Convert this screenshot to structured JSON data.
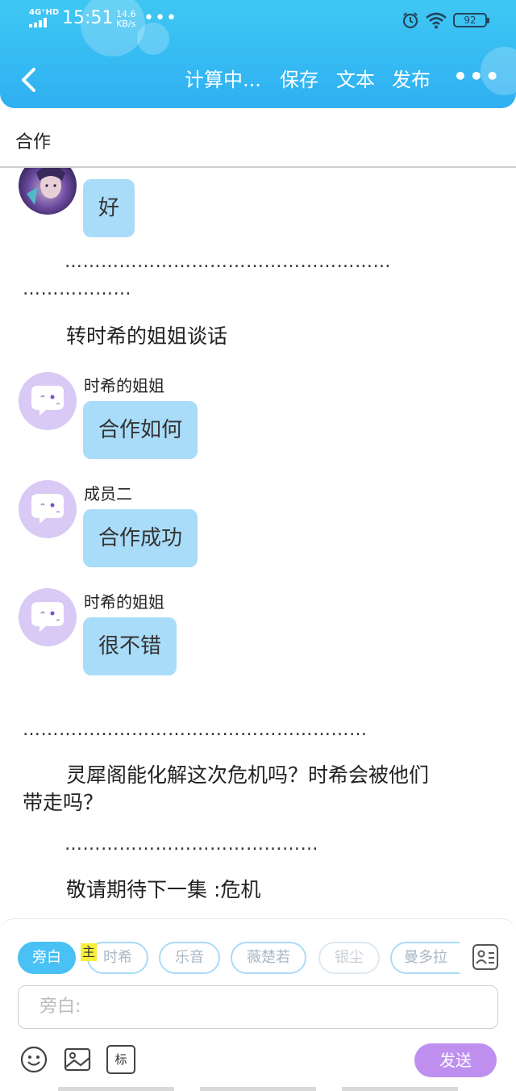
{
  "status_bar": {
    "network": "4G⁺HD",
    "time": "15:51",
    "speed_value": "14.6",
    "speed_unit": "KB/s",
    "more": "•••",
    "battery": "92"
  },
  "navbar": {
    "items": [
      "计算中...",
      "保存",
      "文本",
      "发布"
    ],
    "more": "•••"
  },
  "chapter_title": "合作",
  "conversation": {
    "first_message": "好",
    "dots_1a": "………………………………………………",
    "dots_1b": "………………",
    "narration_1": "转时希的姐姐谈话",
    "messages": [
      {
        "sender": "时希的姐姐",
        "text": "合作如何"
      },
      {
        "sender": "成员二",
        "text": "合作成功"
      },
      {
        "sender": "时希的姐姐",
        "text": "很不错"
      }
    ],
    "dots_2": "…………………………………………………",
    "narration_2_line1": "灵犀阁能化解这次危机吗？时希会被他们",
    "narration_2_line2": "带走吗？",
    "dots_3": "……………………………………",
    "narration_3": "敬请期待下一集 :危机"
  },
  "input_panel": {
    "roles": [
      "旁白",
      "时希",
      "乐音",
      "薇楚若",
      "银尘",
      "曼多拉"
    ],
    "main_tag": "主",
    "placeholder": "旁白:",
    "send_label": "发送",
    "tool_tag_label": "标"
  },
  "colors": {
    "header": "#3fc7f3",
    "bubble": "#a9dcf9",
    "avatar_bg": "#d9c9f5",
    "send": "#bf8ff0",
    "active_role": "#49c1f4"
  }
}
